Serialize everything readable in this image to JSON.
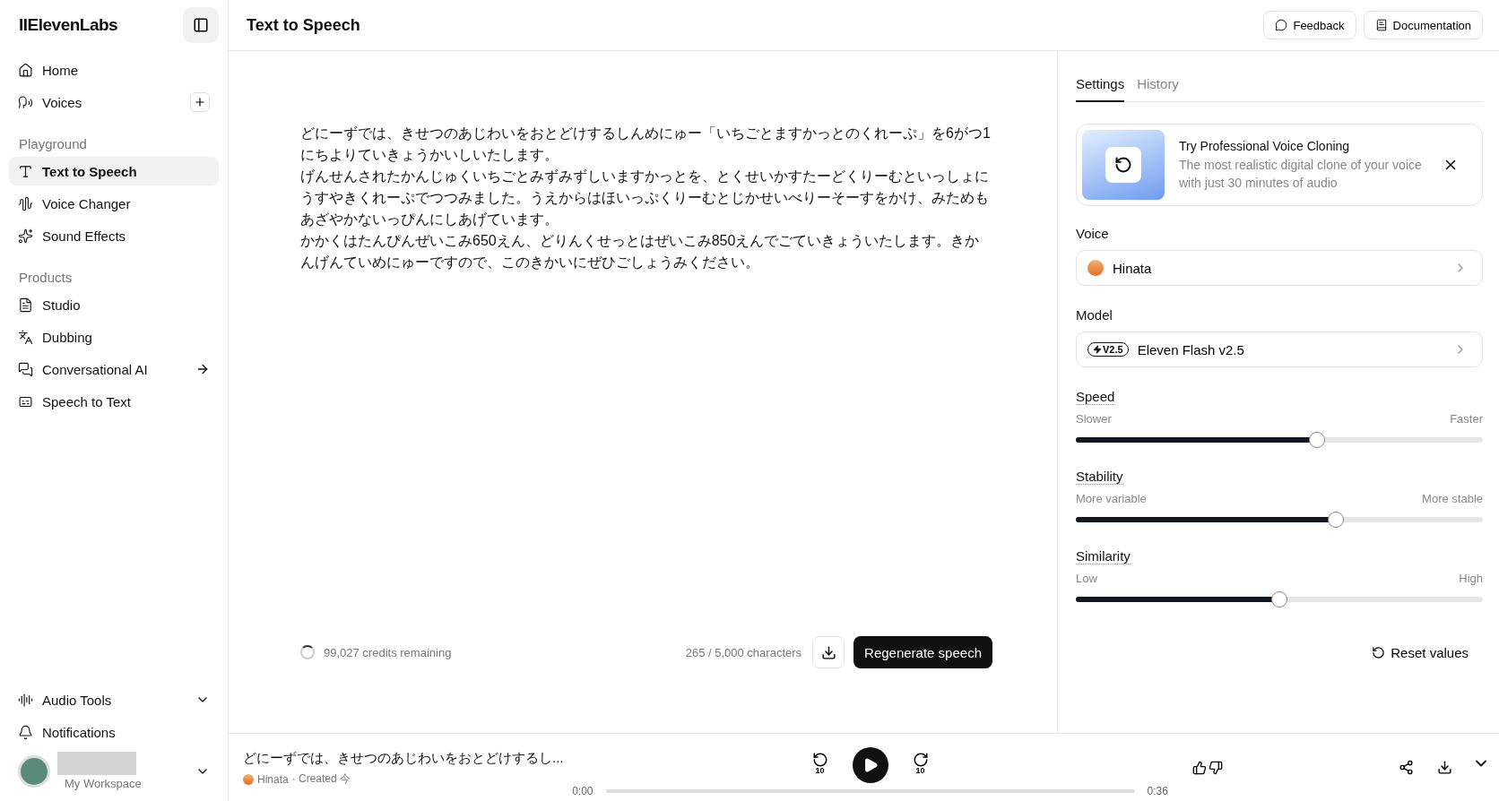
{
  "sidebar": {
    "logo": "IIElevenLabs",
    "top_items": [
      {
        "label": "Home",
        "selected": false,
        "kind": "plain"
      },
      {
        "label": "Voices",
        "selected": false,
        "kind": "add"
      }
    ],
    "sections": [
      {
        "title": "Playground",
        "items": [
          {
            "label": "Text to Speech",
            "selected": true,
            "kind": "plain"
          },
          {
            "label": "Voice Changer",
            "selected": false,
            "kind": "plain"
          },
          {
            "label": "Sound Effects",
            "selected": false,
            "kind": "plain"
          }
        ]
      },
      {
        "title": "Products",
        "items": [
          {
            "label": "Studio",
            "selected": false,
            "kind": "plain"
          },
          {
            "label": "Dubbing",
            "selected": false,
            "kind": "plain"
          },
          {
            "label": "Conversational AI",
            "selected": false,
            "kind": "link"
          },
          {
            "label": "Speech to Text",
            "selected": false,
            "kind": "plain"
          }
        ]
      }
    ],
    "bottom_items": [
      {
        "label": "Audio Tools",
        "expanded": false
      },
      {
        "label": "Notifications"
      }
    ],
    "workspace": "My Workspace"
  },
  "header": {
    "title": "Text to Speech",
    "buttons": [
      "Feedback",
      "Documentation"
    ]
  },
  "editor": {
    "paragraphs": [
      "どにーずでは、きせつのあじわいをおとどけするしんめにゅー「いちごとますかっとのくれーぷ」を6がつ1にちよりていきょうかいしいたします。",
      "げんせんされたかんじゅくいちごとみずみずしいますかっとを、とくせいかすたーどくりーむといっしょにうすやきくれーぷでつつみました。うえからはほいっぷくりーむとじかせいべりーそーすをかけ、みためもあざやかないっぴんにしあげています。",
      "かかくはたんぴんぜいこみ650えん、どりんくせっとはぜいこみ850えんでごていきょういたします。きかんげんていめにゅーですので、このきかいにぜひごしょうみください。"
    ],
    "credits": "99,027 credits remaining",
    "characters": "265 / 5,000 characters",
    "generate_button": "Regenerate speech"
  },
  "settings": {
    "tabs": [
      {
        "label": "Settings",
        "selected": true
      },
      {
        "label": "History",
        "selected": false
      }
    ],
    "promo": {
      "title": "Try Professional Voice Cloning",
      "text": "The most realistic digital clone of your voice with just 30 minutes of audio"
    },
    "voice": {
      "label": "Voice",
      "value": "Hinata"
    },
    "model": {
      "label": "Model",
      "badge": "V2.5",
      "value": "Eleven Flash v2.5"
    },
    "sliders": [
      {
        "label": "Speed",
        "min_label": "Slower",
        "max_label": "Faster",
        "level": 0.596
      },
      {
        "label": "Stability",
        "min_label": "More variable",
        "max_label": "More stable",
        "level": 0.645
      },
      {
        "label": "Similarity",
        "min_label": "Low",
        "max_label": "High",
        "level": 0.5
      }
    ],
    "reset_button": "Reset values"
  },
  "player": {
    "title": "どにーずでは、きせつのあじわいをおとどけするし...",
    "voice": "Hinata",
    "created": "· Created 今",
    "elapsed": "0:00",
    "total": "0:36",
    "skip_back": "10",
    "skip_forward": "10"
  }
}
